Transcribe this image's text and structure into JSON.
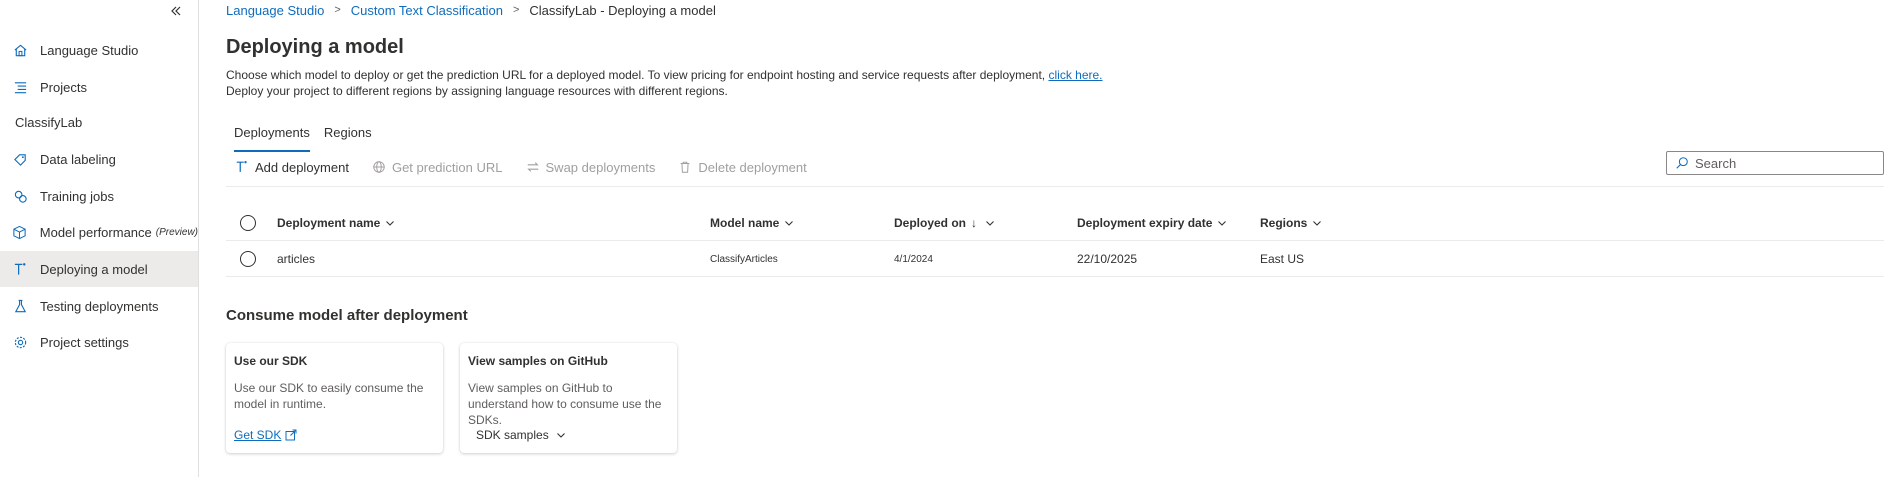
{
  "sidebar": {
    "items": [
      {
        "label": "Language Studio",
        "icon": "home-icon"
      },
      {
        "label": "Projects",
        "icon": "list-icon"
      },
      {
        "label": "Data labeling",
        "icon": "tag-icon"
      },
      {
        "label": "Training jobs",
        "icon": "training-icon"
      },
      {
        "label": "Model performance",
        "preview": "(Preview)",
        "icon": "cube-icon"
      },
      {
        "label": "Deploying a model",
        "icon": "deploy-icon"
      },
      {
        "label": "Testing deployments",
        "icon": "flask-icon"
      },
      {
        "label": "Project settings",
        "icon": "gear-icon"
      }
    ],
    "project_name": "ClassifyLab",
    "active": "Deploying a model"
  },
  "breadcrumb": {
    "items": [
      "Language Studio",
      "Custom Text Classification"
    ],
    "current": "ClassifyLab - Deploying a model"
  },
  "page": {
    "title": "Deploying a model",
    "description_line1": "Choose which model to deploy or get the prediction URL for a deployed model. To view pricing for endpoint hosting and service requests after deployment,",
    "description_link": "click here.",
    "description_line2": "Deploy your project to different regions by assigning language resources with different regions."
  },
  "tabs": [
    "Deployments",
    "Regions"
  ],
  "toolbar": {
    "add": "Add deployment",
    "get_url": "Get prediction URL",
    "swap": "Swap deployments",
    "delete": "Delete deployment"
  },
  "search": {
    "placeholder": "Search"
  },
  "table": {
    "columns": [
      "Deployment name",
      "Model name",
      "Deployed on",
      "Deployment expiry date",
      "Regions"
    ],
    "sort_indicator": "↓",
    "rows": [
      {
        "deployment_name": "articles",
        "model_name": "ClassifyArticles",
        "deployed_on": "4/1/2024",
        "expiry": "22/10/2025",
        "region": "East US"
      }
    ]
  },
  "consume": {
    "title": "Consume model after deployment",
    "cards": [
      {
        "title": "Use our SDK",
        "desc": "Use our SDK to easily consume the model in runtime.",
        "action": "Get SDK"
      },
      {
        "title": "View samples on GitHub",
        "desc": "View samples on GitHub to understand how to consume use the SDKs.",
        "action": "SDK samples"
      }
    ]
  },
  "colors": {
    "accent": "#0f6cbd",
    "text": "#323130",
    "disabled": "#a19f9d",
    "active_bg": "#edebe9"
  }
}
